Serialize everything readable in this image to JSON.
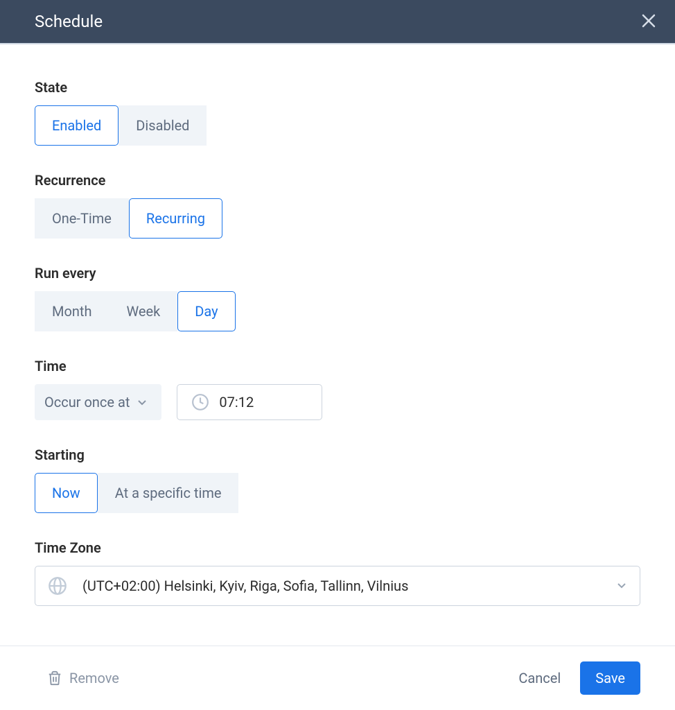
{
  "header": {
    "title": "Schedule"
  },
  "state": {
    "label": "State",
    "options": [
      "Enabled",
      "Disabled"
    ],
    "selected": "Enabled"
  },
  "recurrence": {
    "label": "Recurrence",
    "options": [
      "One-Time",
      "Recurring"
    ],
    "selected": "Recurring"
  },
  "runEvery": {
    "label": "Run every",
    "options": [
      "Month",
      "Week",
      "Day"
    ],
    "selected": "Day"
  },
  "time": {
    "label": "Time",
    "occurLabel": "Occur once at",
    "value": "07:12"
  },
  "starting": {
    "label": "Starting",
    "options": [
      "Now",
      "At a specific time"
    ],
    "selected": "Now"
  },
  "timezone": {
    "label": "Time Zone",
    "value": "(UTC+02:00) Helsinki, Kyiv, Riga, Sofia, Tallinn, Vilnius"
  },
  "footer": {
    "remove": "Remove",
    "cancel": "Cancel",
    "save": "Save"
  }
}
